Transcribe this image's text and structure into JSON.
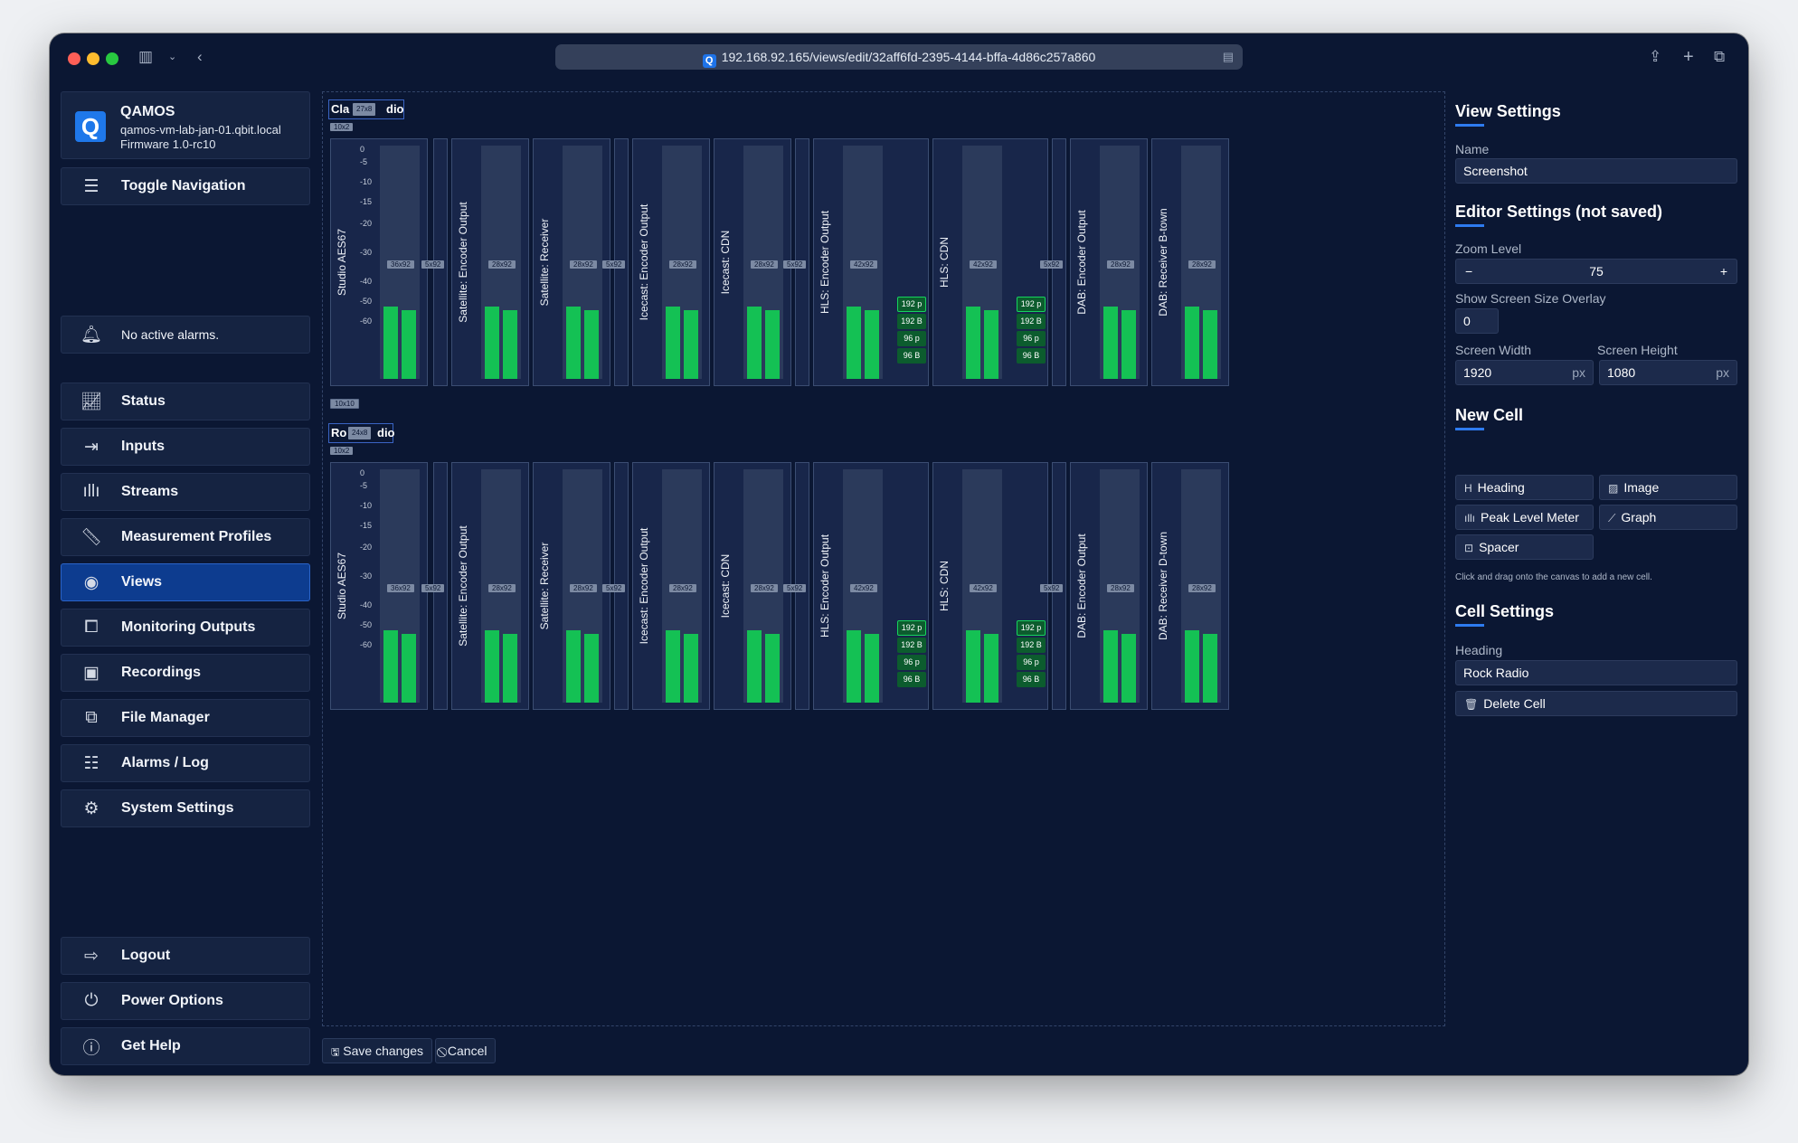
{
  "browser": {
    "url": "192.168.92.165/views/edit/32aff6fd-2395-4144-bffa-4d86c257a860"
  },
  "brand": {
    "name": "QAMOS",
    "host": "qamos-vm-lab-jan-01.qbit.local",
    "firmware": "Firmware 1.0-rc10",
    "logo_letter": "Q"
  },
  "sidebar": {
    "toggle": "Toggle Navigation",
    "alarms": "No active alarms.",
    "items": [
      {
        "label": "Status",
        "icon": "chart-line-icon"
      },
      {
        "label": "Inputs",
        "icon": "sign-in-icon"
      },
      {
        "label": "Streams",
        "icon": "waveform-icon"
      },
      {
        "label": "Measurement Profiles",
        "icon": "ruler-icon"
      },
      {
        "label": "Views",
        "icon": "eye-icon",
        "active": true
      },
      {
        "label": "Monitoring Outputs",
        "icon": "monitor-output-icon"
      },
      {
        "label": "Recordings",
        "icon": "recordings-icon"
      },
      {
        "label": "File Manager",
        "icon": "files-icon"
      },
      {
        "label": "Alarms / Log",
        "icon": "log-icon"
      },
      {
        "label": "System Settings",
        "icon": "gear-icon"
      }
    ],
    "bottom": [
      {
        "label": "Logout",
        "icon": "logout-icon"
      },
      {
        "label": "Power Options",
        "icon": "power-icon"
      },
      {
        "label": "Get Help",
        "icon": "help-icon"
      }
    ]
  },
  "canvas": {
    "row1_heading": "Cla",
    "row1_heading_tail": "dio",
    "row2_heading": "Ro",
    "row2_heading_tail": "dio",
    "heading_size_1": "27x8",
    "heading_size_2": "24x8",
    "gap_size": "10x2",
    "spacer_size": "10x10",
    "scale": [
      "0",
      "-5",
      "-10",
      "-15",
      "-20",
      "-30",
      "-40",
      "-50",
      "-60"
    ],
    "meters": [
      {
        "label": "Studio AES67",
        "size": "36x92"
      },
      {
        "label": "Satellite: Encoder Output",
        "size": "28x92"
      },
      {
        "label": "Satellite: Receiver",
        "size": "28x92"
      },
      {
        "label": "Icecast: Encoder Output",
        "size": "28x92"
      },
      {
        "label": "Icecast: CDN",
        "size": "28x92"
      },
      {
        "label": "HLS: Encoder Output",
        "size": "42x92"
      },
      {
        "label": "HLS: CDN",
        "size": "42x92"
      },
      {
        "label": "DAB: Encoder Output",
        "size": "28x92"
      },
      {
        "label": "DAB: Receiver B-town",
        "label_row2": "DAB: Receiver D-town",
        "size": "28x92"
      }
    ],
    "spacer_label": "5x92",
    "badges": [
      "192 p",
      "192 B",
      "96 p",
      "96 B"
    ]
  },
  "actions": {
    "save": "Save changes",
    "cancel": "Cancel"
  },
  "panel": {
    "view_settings": "View Settings",
    "name_label": "Name",
    "name_value": "Screenshot",
    "editor_settings": "Editor Settings (not saved)",
    "zoom_label": "Zoom Level",
    "zoom_value": "75",
    "overlay_label": "Show Screen Size Overlay",
    "overlay_value": "0",
    "width_label": "Screen Width",
    "width_value": "1920",
    "height_label": "Screen Height",
    "height_value": "1080",
    "unit": "px",
    "new_cell": "New Cell",
    "new_cell_buttons": [
      "Heading",
      "Image",
      "Peak Level Meter",
      "Graph",
      "Spacer"
    ],
    "hint": "Click and drag onto the canvas to add a new cell.",
    "cell_settings": "Cell Settings",
    "heading_label": "Heading",
    "heading_value": "Rock Radio",
    "delete": "Delete Cell"
  }
}
